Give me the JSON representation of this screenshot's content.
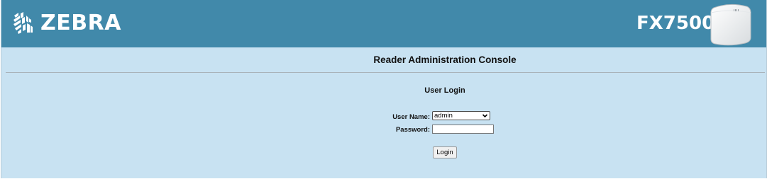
{
  "header": {
    "brand": "ZEBRA",
    "brand_icon": "zebra-head-logo-icon",
    "model": "FX7500",
    "device_icon": "rfid-reader-device-icon",
    "bg_color": "#4189aa"
  },
  "main": {
    "title": "Reader Administration Console",
    "bg_color": "#c8e2f2"
  },
  "login": {
    "heading": "User Login",
    "user_name_label": "User Name:",
    "user_name_value": "admin",
    "password_label": "Password:",
    "password_value": "",
    "submit_label": "Login"
  }
}
